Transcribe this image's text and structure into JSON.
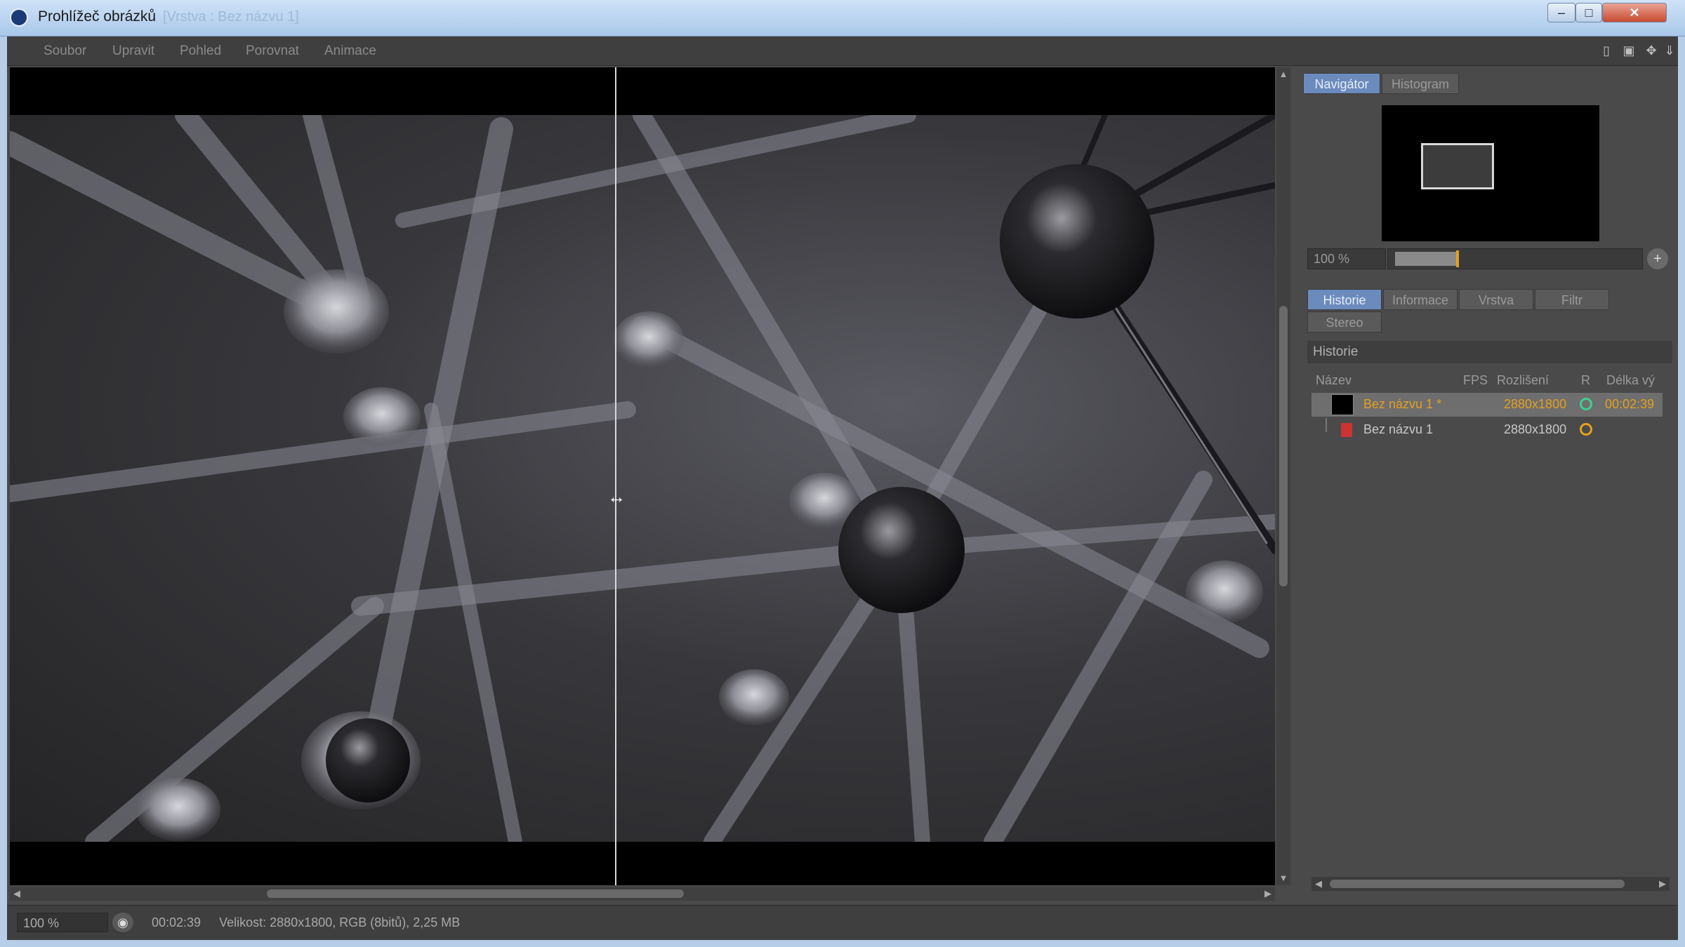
{
  "window": {
    "title": "Prohlížeč obrázků",
    "subtitle": "[Vrstva : Bez názvu 1]",
    "controls": {
      "minimize": "–",
      "maximize": "□",
      "close": "✕"
    }
  },
  "menu": [
    "Soubor",
    "Upravit",
    "Pohled",
    "Porovnat",
    "Animace"
  ],
  "toolbar_icons": [
    "panel-icon",
    "layout-icon",
    "move-icon",
    "pin-icon"
  ],
  "navigator": {
    "tabs": [
      "Navigátor",
      "Histogram"
    ],
    "zoom": "100 %",
    "zoom_level": 0.26,
    "plus": "+"
  },
  "history_tabs": [
    "Historie",
    "Informace",
    "Vrstva",
    "Filtr",
    "Stereo"
  ],
  "history": {
    "title": "Historie",
    "columns": [
      "Název",
      "FPS",
      "Rozlišení",
      "R",
      "Délka vý"
    ],
    "rows": [
      {
        "name": "Bez názvu 1 *",
        "resolution": "2880x1800",
        "length": "00:02:39",
        "status_color": "#3ccf8e",
        "highlight_color": "#e3a020"
      },
      {
        "name": "Bez názvu 1",
        "resolution": "2880x1800",
        "length": "",
        "status_color": "#e3a020"
      }
    ]
  },
  "status_bar": {
    "zoom": "100 %",
    "time": "00:02:39",
    "info": "Velikost: 2880x1800, RGB (8bitů), 2,25 MB"
  },
  "viewport": {
    "split_handle": "↔"
  }
}
